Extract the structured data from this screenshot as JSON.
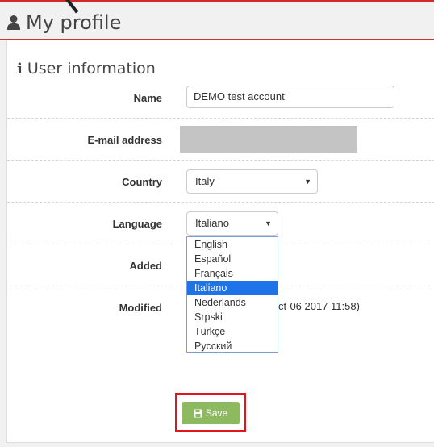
{
  "header": {
    "title": "My profile",
    "icon": "user-icon"
  },
  "panel": {
    "title": "User information",
    "icon": "info-icon"
  },
  "fields": {
    "name_label": "Name",
    "name_value": "DEMO test account",
    "email_label": "E-mail address",
    "country_label": "Country",
    "country_value": "Italy",
    "language_label": "Language",
    "language_value": "Italiano",
    "added_label": "Added",
    "modified_label": "Modified",
    "modified_value_visible": "ct-06 2017 11:58)"
  },
  "language_options": [
    "English",
    "Español",
    "Français",
    "Italiano",
    "Nederlands",
    "Srpski",
    "Türkçe",
    "Русский"
  ],
  "language_selected": "Italiano",
  "save_label": "Save",
  "colors": {
    "accent_red": "#d2282f",
    "save_green": "#8dba61",
    "highlight_blue": "#1e73e8",
    "redacted_gray": "#c4c4c4"
  }
}
